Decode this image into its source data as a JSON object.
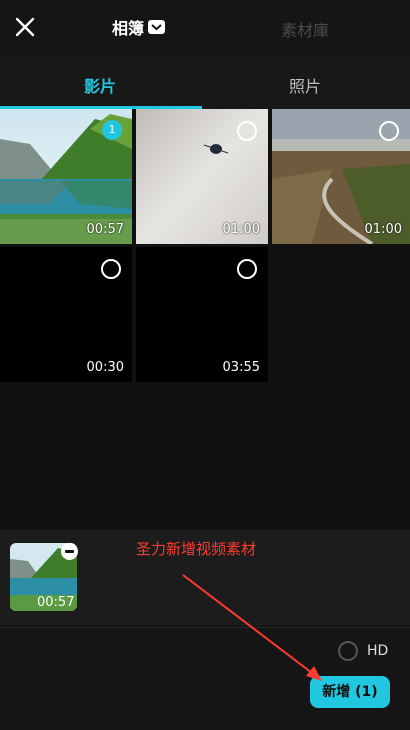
{
  "header": {
    "title": "相簿",
    "right_tab": "素材庫"
  },
  "tabs": [
    {
      "label": "影片"
    },
    {
      "label": "照片"
    }
  ],
  "media": [
    {
      "duration": "00:57",
      "selected": true,
      "badge": "1"
    },
    {
      "duration": "01:00",
      "selected": false
    },
    {
      "duration": "01:00",
      "selected": false
    },
    {
      "duration": "00:30",
      "selected": false
    },
    {
      "duration": "03:55",
      "selected": false
    }
  ],
  "tray": {
    "thumb_duration": "00:57"
  },
  "annotation": "圣力新增视频素材",
  "footer": {
    "hd_label": "HD",
    "add_label": "新增 (1)"
  },
  "colors": {
    "accent": "#21c6e0",
    "annotation": "#ff3b30"
  }
}
